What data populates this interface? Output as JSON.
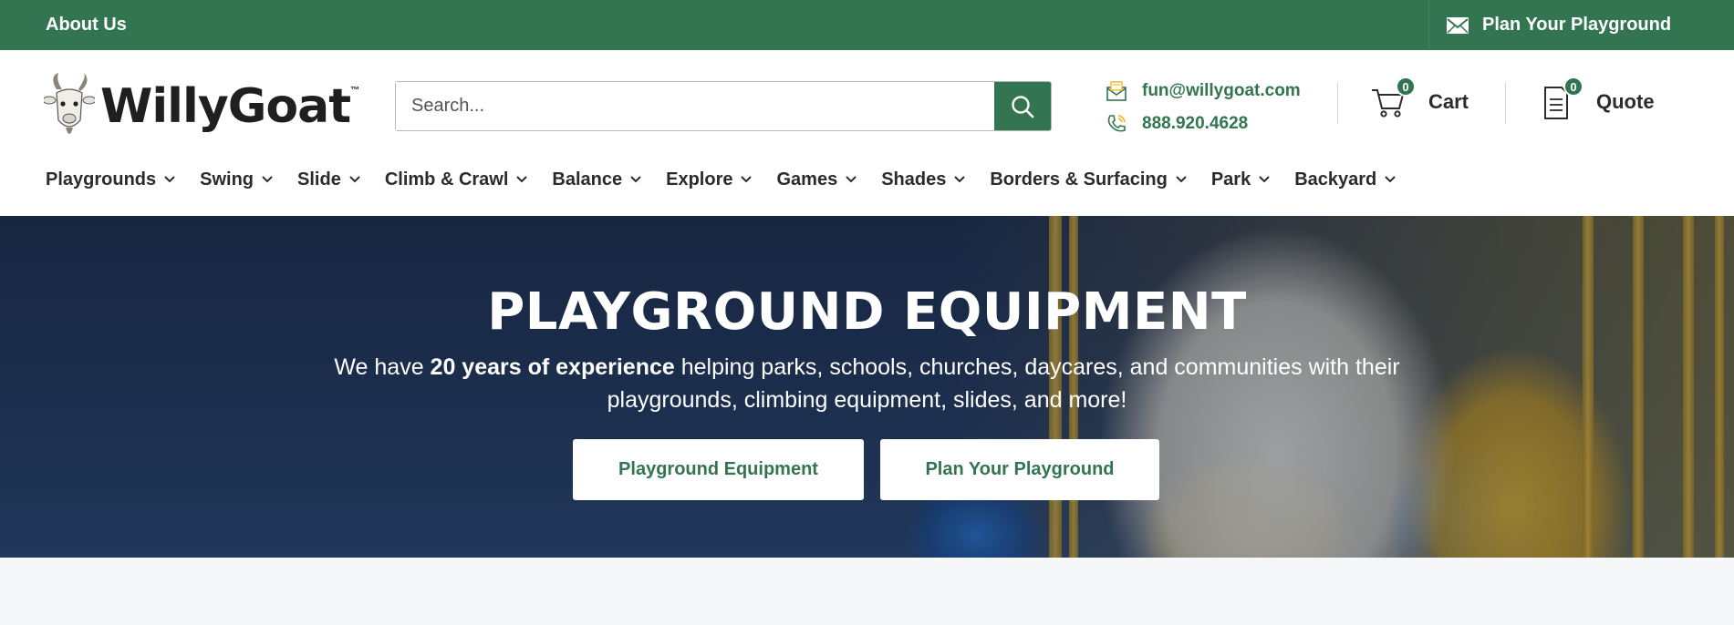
{
  "topbar": {
    "about_label": "About Us",
    "plan_label": "Plan Your Playground",
    "plan_icon": "mail-icon"
  },
  "logo": {
    "wordmark": "WillyGoat",
    "trademark": "™"
  },
  "search": {
    "placeholder": "Search...",
    "button_icon": "search-icon"
  },
  "contact": {
    "email": "fun@willygoat.com",
    "phone": "888.920.4628"
  },
  "cart": {
    "label": "Cart",
    "count": "0"
  },
  "quote": {
    "label": "Quote",
    "count": "0"
  },
  "nav": {
    "items": [
      {
        "label": "Playgrounds"
      },
      {
        "label": "Swing"
      },
      {
        "label": "Slide"
      },
      {
        "label": "Climb & Crawl"
      },
      {
        "label": "Balance"
      },
      {
        "label": "Explore"
      },
      {
        "label": "Games"
      },
      {
        "label": "Shades"
      },
      {
        "label": "Borders & Surfacing"
      },
      {
        "label": "Park"
      },
      {
        "label": "Backyard"
      }
    ]
  },
  "hero": {
    "title": "PLAYGROUND EQUIPMENT",
    "text_pre": "We have ",
    "text_bold": "20 years of experience",
    "text_post": " helping parks, schools, churches, daycares, and communities with their playgrounds, climbing equipment, slides, and more!",
    "cta_primary": "Playground Equipment",
    "cta_secondary": "Plan Your Playground"
  },
  "colors": {
    "brand_green": "#327550",
    "text_dark": "#2b2b2b"
  }
}
